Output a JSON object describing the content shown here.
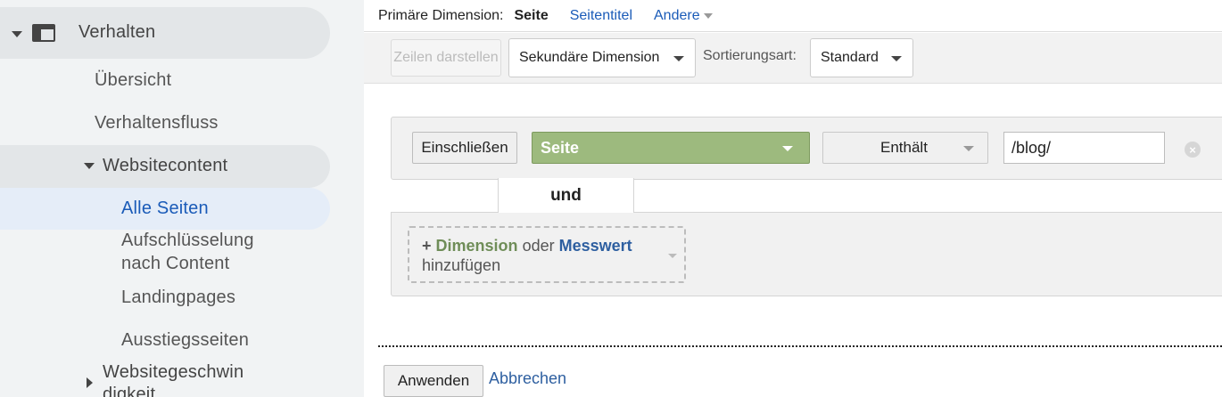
{
  "sidebar": {
    "behavior": {
      "label": "Verhalten",
      "icon": "window-icon"
    },
    "items": [
      {
        "label": "Übersicht"
      },
      {
        "label": "Verhaltensfluss"
      }
    ],
    "site_content": {
      "label": "Websitecontent",
      "children": [
        {
          "label": "Alle Seiten",
          "active": true
        },
        {
          "label_line1": "Aufschlüsselung",
          "label_line2": "nach Content"
        },
        {
          "label": "Landingpages"
        },
        {
          "label": "Ausstiegsseiten"
        }
      ]
    },
    "site_speed": {
      "label_line1": "Websitegeschwin",
      "label_line2": "digkeit"
    }
  },
  "dimension_bar": {
    "label": "Primäre Dimension:",
    "selected": "Seite",
    "option_page_title": "Seitentitel",
    "option_other": "Andere"
  },
  "toolbar": {
    "plot_rows": "Zeilen darstellen",
    "secondary_dimension": "Sekundäre Dimension",
    "sort_label": "Sortierungsart:",
    "sort_value": "Standard"
  },
  "filter": {
    "include_label": "Einschließen",
    "dimension_value": "Seite",
    "match_value": "Enthält",
    "input_value": "/blog/",
    "close_glyph": "×",
    "and_label": "und",
    "add_plus": "+",
    "add_dimension": "Dimension",
    "add_or": "oder",
    "add_metric": "Messwert",
    "add_suffix": "hinzufügen"
  },
  "actions": {
    "apply": "Anwenden",
    "cancel": "Abbrechen"
  },
  "colors": {
    "accent_blue": "#1a5bb8",
    "dimension_green": "#9dba7e",
    "sidebar_bg": "#f1f3f4"
  }
}
